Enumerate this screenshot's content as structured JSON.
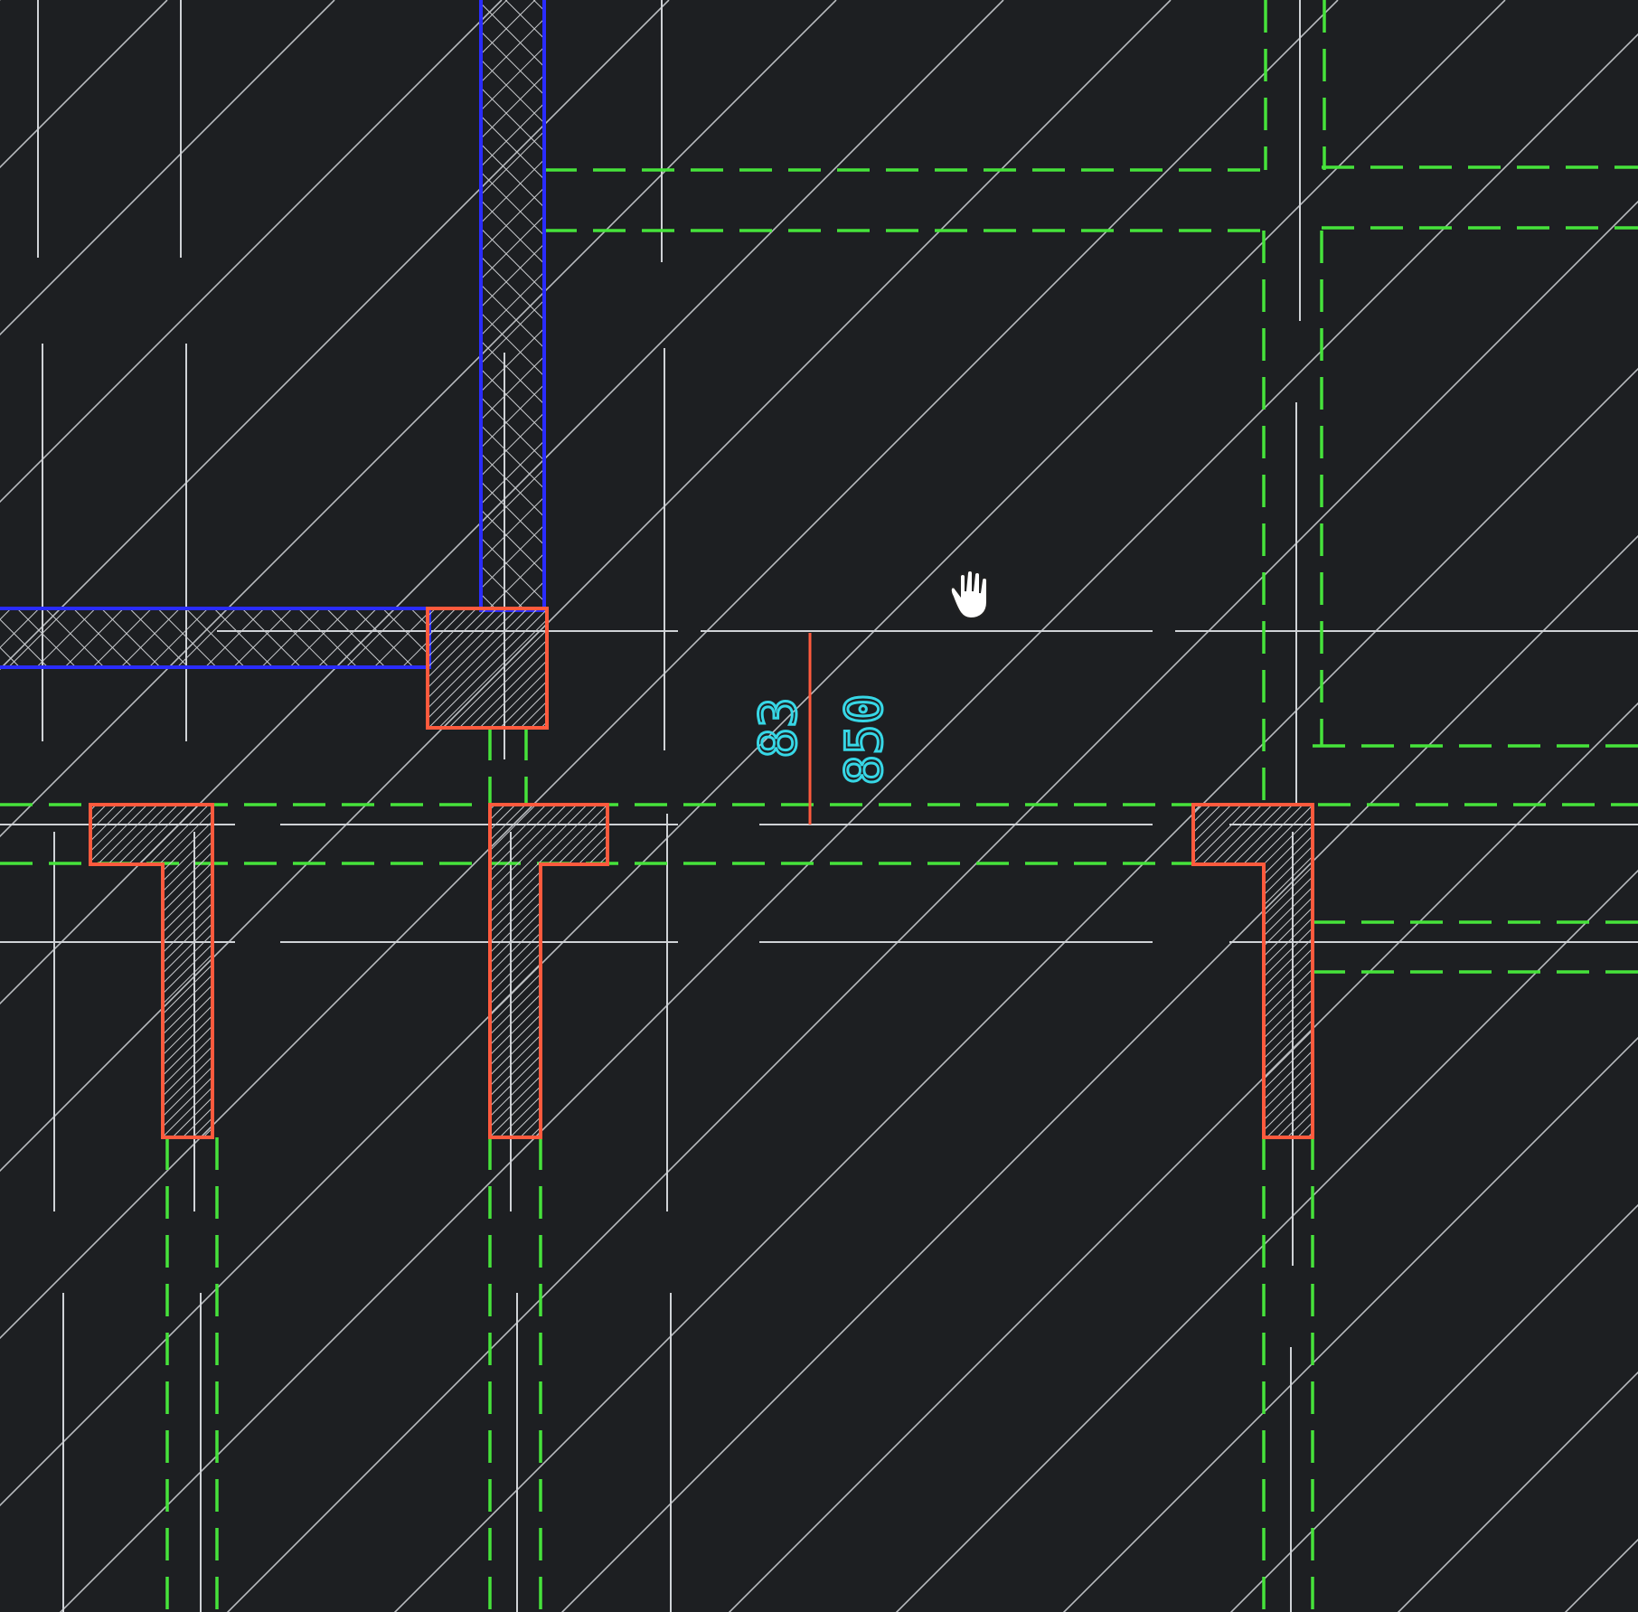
{
  "app": {
    "viewport": "cad-drawing-viewport",
    "background_color": "#1d1f22"
  },
  "colors": {
    "grid_line": "#cfd2d6",
    "hatch_diagonal": "#b9bcc0",
    "green_dashed": "#46e33b",
    "red_outline": "#ff5a3d",
    "blue_wall": "#2a2cff",
    "cyan_text": "#37d7e6",
    "column_hatch": "#bfc1c4"
  },
  "dimension": {
    "value_main": "850",
    "value_side": "83",
    "color": "#37d7e6"
  },
  "cursor": {
    "icon": "hand-pan-icon"
  }
}
